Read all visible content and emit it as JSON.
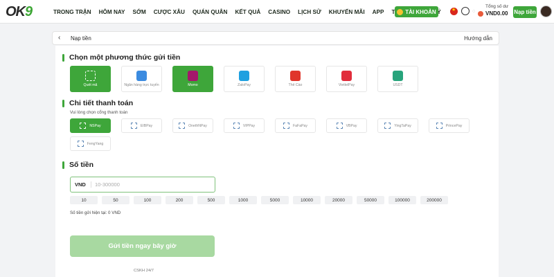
{
  "header": {
    "logo": {
      "main": "OK",
      "accent": "9"
    },
    "nav": [
      "TRONG TRẬN",
      "HÔM NAY",
      "SỚM",
      "CƯỢC XÂU",
      "QUÁN QUÂN",
      "KẾT QUẢ",
      "CASINO",
      "LỊCH SỬ",
      "KHUYẾN MÃI",
      "APP",
      "TÀI TRỢ",
      "ĐẠI LÝ"
    ],
    "account_label": "TÀI KHOẢN",
    "balance_label": "Tổng số dư",
    "balance_value": "VND0.00",
    "deposit_label": "Nạp tiền"
  },
  "panel": {
    "back_icon": "‹",
    "title": "Nạp tiền",
    "guide": "Hướng dẫn"
  },
  "methods_section": {
    "title": "Chọn một phương thức gửi tiền",
    "items": [
      {
        "label": "Quét mã",
        "icon": "qr-icon",
        "color": "#3ea63a",
        "active": true
      },
      {
        "label": "Ngân hàng trực tuyến",
        "icon": "bank-icon",
        "color": "#3b8be0",
        "active": false
      },
      {
        "label": "Momo",
        "icon": "momo-icon",
        "color": "#a4186b",
        "active": true
      },
      {
        "label": "ZaloPay",
        "icon": "zalopay-icon",
        "color": "#1ea0e0",
        "active": false
      },
      {
        "label": "Thẻ Cào",
        "icon": "card-icon",
        "color": "#e0352b",
        "active": false
      },
      {
        "label": "ViettelPay",
        "icon": "viettel-icon",
        "color": "#e12d3c",
        "active": false
      },
      {
        "label": "USDT",
        "icon": "usdt-icon",
        "color": "#28a47c",
        "active": false
      }
    ]
  },
  "details_section": {
    "title": "Chi tiết thanh toán",
    "hint": "Vui lòng chọn cổng thanh toán",
    "gateways": [
      "NSPay",
      "EIBPay",
      "OnethNPay",
      "VIPPay",
      "FaFaPay",
      "VBPay",
      "YingTaPay",
      "PrincePay",
      "FengYang"
    ]
  },
  "amount_section": {
    "title": "Số tiền",
    "currency": "VND",
    "placeholder": "10-300000",
    "presets": [
      "10",
      "50",
      "100",
      "200",
      "500",
      "1000",
      "5000",
      "10000",
      "20000",
      "50000",
      "100000",
      "200000"
    ],
    "current": "Số tiền gửi hiện tại: 0 VND"
  },
  "submit_label": "Gửi tiền ngay bây giờ",
  "footer_text": "CSKH 24/7"
}
